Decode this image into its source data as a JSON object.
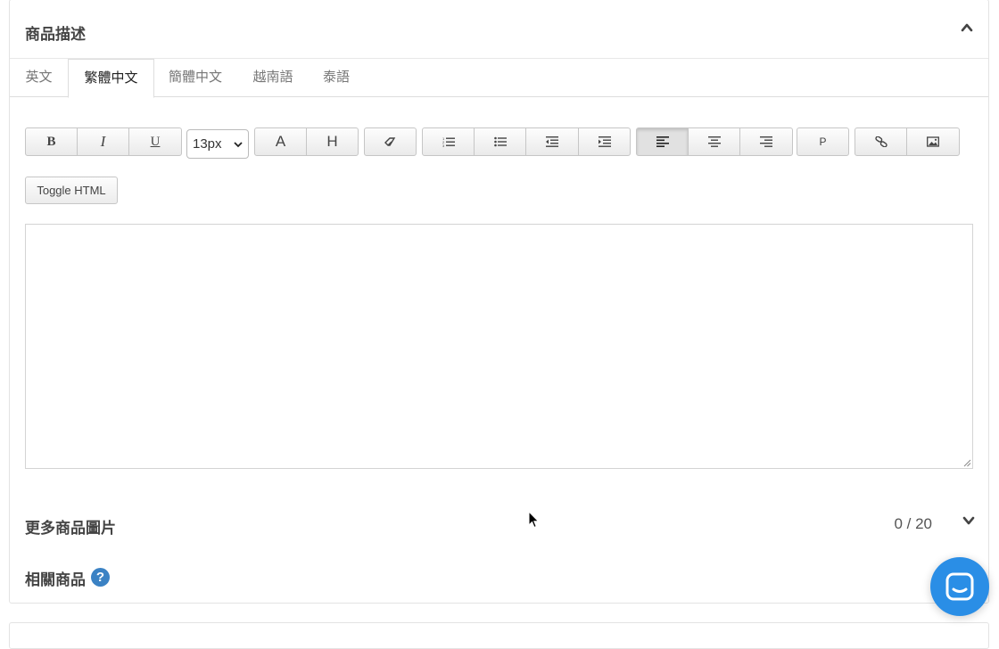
{
  "panel": {
    "title": "商品描述"
  },
  "tabs": [
    {
      "label": "英文",
      "active": false
    },
    {
      "label": "繁體中文",
      "active": true
    },
    {
      "label": "簡體中文",
      "active": false
    },
    {
      "label": "越南語",
      "active": false
    },
    {
      "label": "泰語",
      "active": false
    }
  ],
  "toolbar": {
    "bold": "B",
    "italic": "I",
    "underline": "U",
    "font_size": "13px",
    "font_color": "A",
    "highlight": "H",
    "paragraph": "P",
    "toggle_html": "Toggle HTML",
    "active_alignment": "left"
  },
  "editor": {
    "content": ""
  },
  "more_images": {
    "label": "更多商品圖片",
    "counter": "0 / 20"
  },
  "related": {
    "label": "相關商品",
    "help": "?"
  },
  "colors": {
    "accent": "#3b82c4",
    "chat": "#2a8ee6"
  }
}
